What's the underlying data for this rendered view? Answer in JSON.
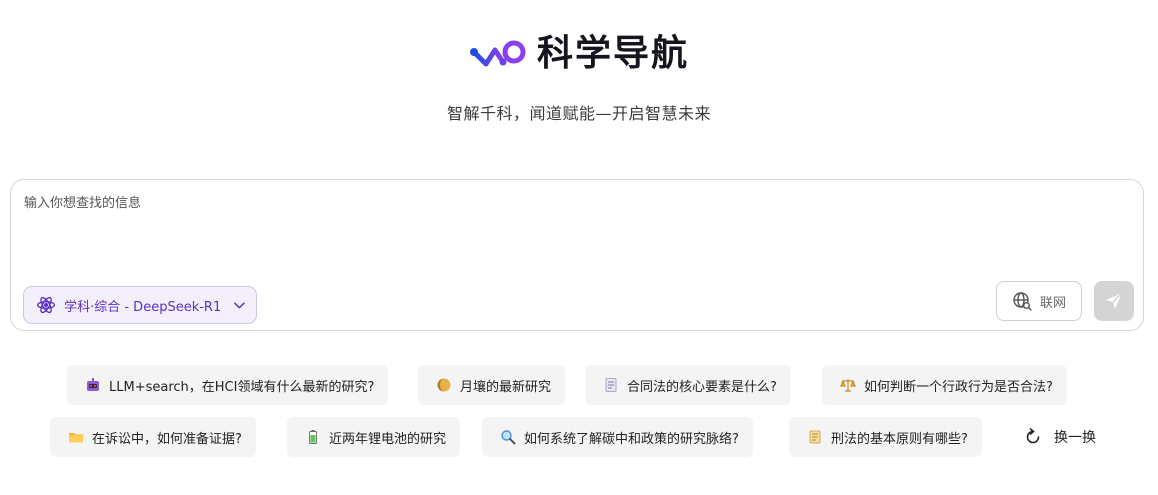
{
  "header": {
    "title": "科学导航",
    "subtitle": "智解千科，闻道赋能—开启智慧未来",
    "brand_colors": [
      "#1f4fe0",
      "#8a3ff0"
    ]
  },
  "search": {
    "placeholder": "输入你想查找的信息",
    "value": "",
    "model_label": "学科·综合 - DeepSeek-R1",
    "model_icon": "atom-icon",
    "web_label": "联网",
    "web_icon": "globe-search-icon",
    "send_icon": "send-icon",
    "accent": "#5b2fc4"
  },
  "suggestions": [
    {
      "icon": "robot-icon",
      "label": "LLM+search，在HCI领域有什么最新的研究?"
    },
    {
      "icon": "moon-icon",
      "label": "月壤的最新研究"
    },
    {
      "icon": "document-icon",
      "label": "合同法的核心要素是什么?"
    },
    {
      "icon": "scales-icon",
      "label": "如何判断一个行政行为是否合法?"
    },
    {
      "icon": "folder-icon",
      "label": "在诉讼中，如何准备证据?"
    },
    {
      "icon": "battery-icon",
      "label": "近两年锂电池的研究"
    },
    {
      "icon": "magnifier-icon",
      "label": "如何系统了解碳中和政策的研究脉络?"
    },
    {
      "icon": "scroll-icon",
      "label": "刑法的基本原则有哪些?"
    }
  ],
  "refresh": {
    "label": "换一换",
    "icon": "refresh-icon"
  }
}
